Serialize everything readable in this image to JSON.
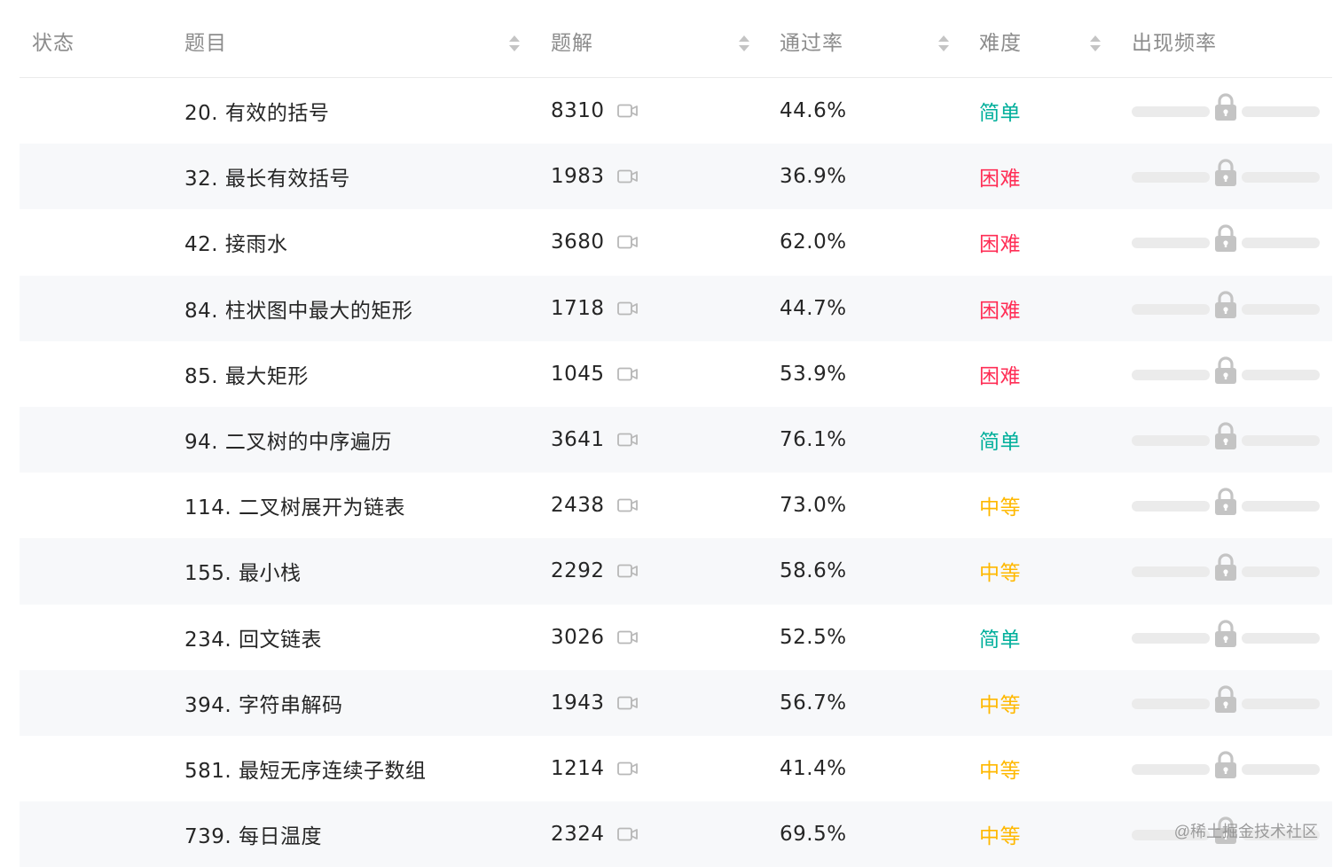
{
  "columns": {
    "status": "状态",
    "title": "题目",
    "solutions": "题解",
    "pass_rate": "通过率",
    "difficulty": "难度",
    "frequency": "出现频率"
  },
  "rows": [
    {
      "title": "20. 有效的括号",
      "solutions": "8310",
      "pass_rate": "44.6%",
      "difficulty": "简单",
      "level": "easy"
    },
    {
      "title": "32. 最长有效括号",
      "solutions": "1983",
      "pass_rate": "36.9%",
      "difficulty": "困难",
      "level": "hard"
    },
    {
      "title": "42. 接雨水",
      "solutions": "3680",
      "pass_rate": "62.0%",
      "difficulty": "困难",
      "level": "hard"
    },
    {
      "title": "84. 柱状图中最大的矩形",
      "solutions": "1718",
      "pass_rate": "44.7%",
      "difficulty": "困难",
      "level": "hard"
    },
    {
      "title": "85. 最大矩形",
      "solutions": "1045",
      "pass_rate": "53.9%",
      "difficulty": "困难",
      "level": "hard"
    },
    {
      "title": "94. 二叉树的中序遍历",
      "solutions": "3641",
      "pass_rate": "76.1%",
      "difficulty": "简单",
      "level": "easy"
    },
    {
      "title": "114. 二叉树展开为链表",
      "solutions": "2438",
      "pass_rate": "73.0%",
      "difficulty": "中等",
      "level": "medium"
    },
    {
      "title": "155. 最小栈",
      "solutions": "2292",
      "pass_rate": "58.6%",
      "difficulty": "中等",
      "level": "medium"
    },
    {
      "title": "234. 回文链表",
      "solutions": "3026",
      "pass_rate": "52.5%",
      "difficulty": "简单",
      "level": "easy"
    },
    {
      "title": "394. 字符串解码",
      "solutions": "1943",
      "pass_rate": "56.7%",
      "difficulty": "中等",
      "level": "medium"
    },
    {
      "title": "581. 最短无序连续子数组",
      "solutions": "1214",
      "pass_rate": "41.4%",
      "difficulty": "中等",
      "level": "medium"
    },
    {
      "title": "739. 每日温度",
      "solutions": "2324",
      "pass_rate": "69.5%",
      "difficulty": "中等",
      "level": "medium"
    }
  ],
  "icons": {
    "video": "video-icon",
    "lock": "lock-icon",
    "sort": "sort-icon"
  },
  "colors": {
    "easy": "#00af9b",
    "medium": "#ffb800",
    "hard": "#ff2d55"
  },
  "watermark": "@稀土掘金技术社区"
}
